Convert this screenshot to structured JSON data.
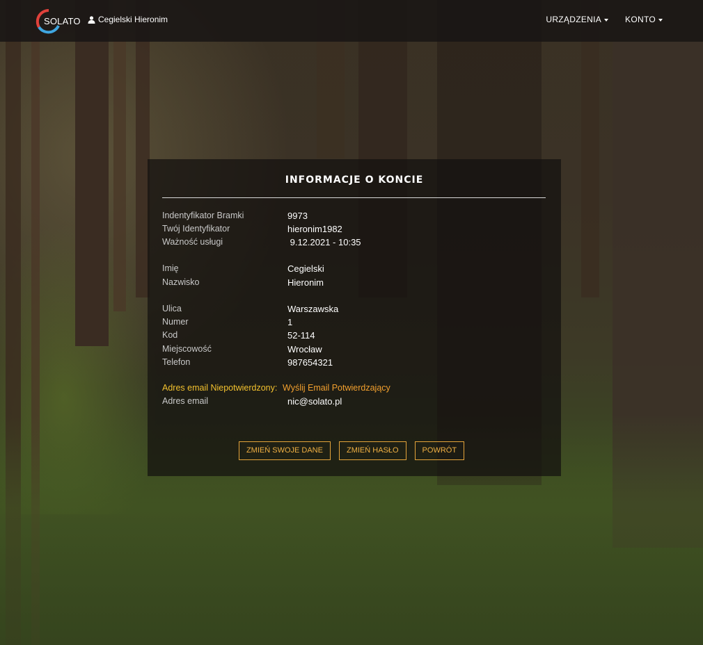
{
  "navbar": {
    "logo_text": "SOLATO",
    "user_name": "Cegielski Hieronim",
    "menu": [
      "URZĄDZENIA",
      "KONTO"
    ]
  },
  "panel": {
    "title": "INFORMACJE O KONCIE",
    "fields": {
      "gateway_id": {
        "label": "Indentyfikator Bramki",
        "value": "9973"
      },
      "your_id": {
        "label": "Twój Identyfikator",
        "value": "hieronim1982"
      },
      "service_validity": {
        "label": "Ważność usługi",
        "value": " 9.12.2021 - 10:35"
      },
      "first_name": {
        "label": "Imię",
        "value": "Cegielski"
      },
      "last_name": {
        "label": "Nazwisko",
        "value": "Hieronim"
      },
      "street": {
        "label": "Ulica",
        "value": "Warszawska"
      },
      "number": {
        "label": "Numer",
        "value": "1"
      },
      "postal_code": {
        "label": "Kod",
        "value": "52-114"
      },
      "city": {
        "label": "Miejscowość",
        "value": "Wrocław"
      },
      "phone": {
        "label": "Telefon",
        "value": "987654321"
      },
      "email_status": {
        "label": "Adres email Niepotwierdzony:",
        "link": "Wyślij Email Potwierdzający"
      },
      "email": {
        "label": "Adres email",
        "value": "nic@solato.pl"
      }
    },
    "buttons": {
      "edit": "ZMIEŃ SWOJE DANE",
      "password": "ZMIEŃ HASŁO",
      "back": "POWRÓT"
    }
  },
  "colors": {
    "accent": "#f0b043",
    "warning": "#f2c12e",
    "logo_red": "#e0413b",
    "logo_blue": "#3fa6e0"
  }
}
